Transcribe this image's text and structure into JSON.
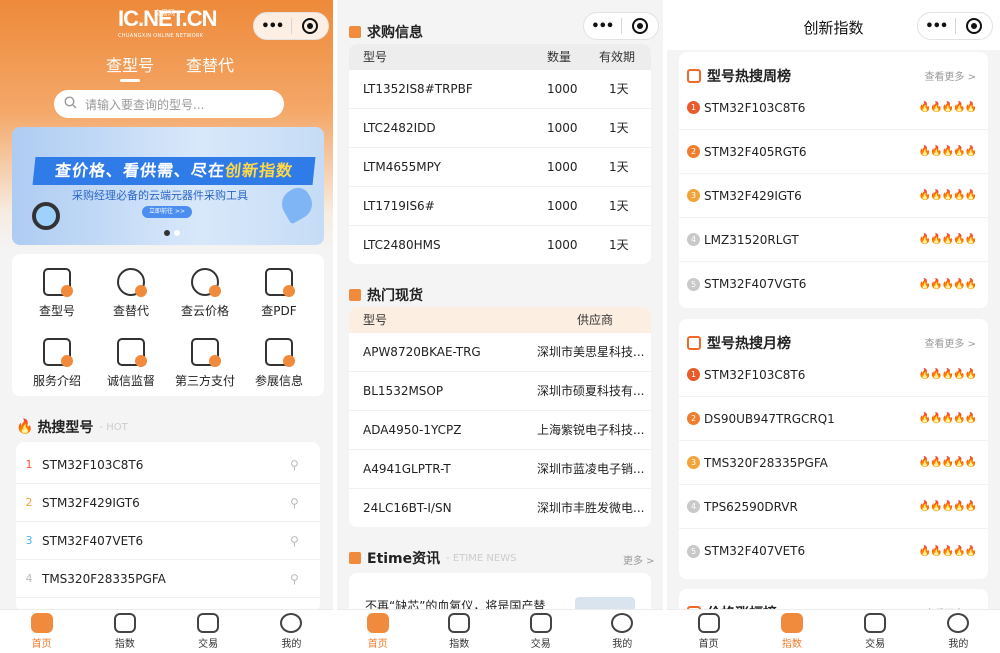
{
  "panel1": {
    "logo_main": "IC.NET.CN",
    "logo_sub": "交易网",
    "logo_small": "CHUANGXIN ONLINE NETWORK",
    "tabs": [
      "查型号",
      "查替代"
    ],
    "search_placeholder": "请输入要查询的型号...",
    "banner": {
      "title_prefix": "查价格、看供需、尽在",
      "title_highlight": "创新指数",
      "subtitle": "采购经理必备的云端元器件采购工具",
      "button": "立即前往 >>"
    },
    "grid": [
      "查型号",
      "查替代",
      "查云价格",
      "查PDF",
      "服务介绍",
      "诚信监督",
      "第三方支付",
      "参展信息"
    ],
    "hot_title": "热搜型号",
    "hot_tag": "- HOT",
    "hot_items": [
      {
        "rank": "1",
        "name": "STM32F103C8T6",
        "color": "#ea5b2b"
      },
      {
        "rank": "2",
        "name": "STM32F429IGT6",
        "color": "#f2a33a"
      },
      {
        "rank": "3",
        "name": "STM32F407VET6",
        "color": "#4fb6e8"
      },
      {
        "rank": "4",
        "name": "TMS320F28335PGFA",
        "color": "#bbbbbb"
      }
    ]
  },
  "panel2": {
    "purchase_title": "求购信息",
    "purchase_headers": [
      "型号",
      "数量",
      "有效期"
    ],
    "purchase_rows": [
      [
        "LT1352IS8#TRPBF",
        "1000",
        "1天"
      ],
      [
        "LTC2482IDD",
        "1000",
        "1天"
      ],
      [
        "LTM4655MPY",
        "1000",
        "1天"
      ],
      [
        "LT1719IS6#",
        "1000",
        "1天"
      ],
      [
        "LTC2480HMS",
        "1000",
        "1天"
      ]
    ],
    "stock_title": "热门现货",
    "stock_headers": [
      "型号",
      "供应商"
    ],
    "stock_rows": [
      [
        "APW8720BKAE-TRG",
        "深圳市美思星科技..."
      ],
      [
        "BL1532MSOP",
        "深圳市硕夏科技有..."
      ],
      [
        "ADA4950-1YCPZ",
        "上海紫锐电子科技..."
      ],
      [
        "A4941GLPTR-T",
        "深圳市蓝凌电子销..."
      ],
      [
        "24LC16BT-I/SN",
        "深圳市丰胜发微电..."
      ]
    ],
    "news_title": "Etime资讯",
    "news_tag": "- ETIME NEWS",
    "news_more": "更多 >",
    "news_item": "不再“缺芯”的血氧仪，将是国产替"
  },
  "panel3": {
    "title": "创新指数",
    "week_title": "型号热搜周榜",
    "week_more": "查看更多 >",
    "week_items": [
      "STM32F103C8T6",
      "STM32F405RGT6",
      "STM32F429IGT6",
      "LMZ31520RLGT",
      "STM32F407VGT6"
    ],
    "month_title": "型号热搜月榜",
    "month_more": "查看更多 >",
    "month_items": [
      "STM32F103C8T6",
      "DS90UB947TRGCRQ1",
      "TMS320F28335PGFA",
      "TPS62590DRVR",
      "STM32F407VET6"
    ],
    "price_title": "价格涨幅榜",
    "price_more": "查看更多 >",
    "flames": "🔥🔥🔥🔥🔥"
  },
  "nav": [
    "首页",
    "指数",
    "交易",
    "我的"
  ],
  "colors": {
    "accent": "#f07a2a"
  }
}
